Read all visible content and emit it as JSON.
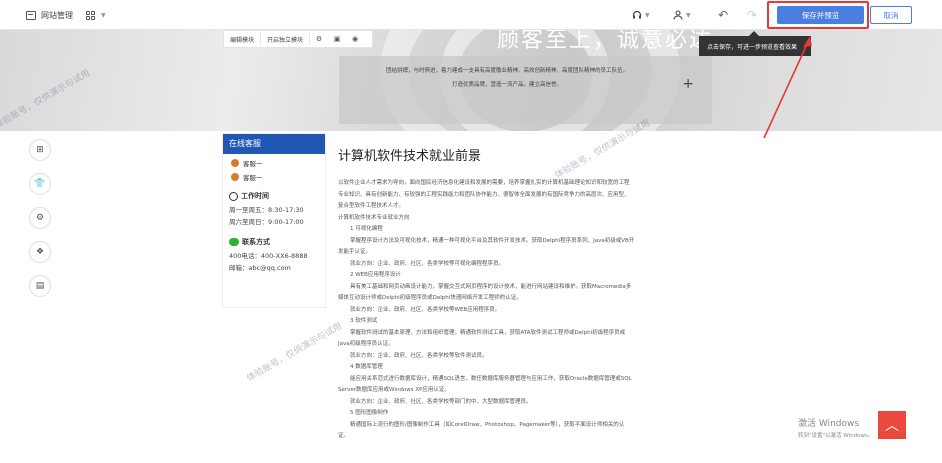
{
  "toolbar": {
    "site_manage": "网站管理",
    "save_preview": "保存并预览",
    "cancel": "取消"
  },
  "banner": {
    "title": "顾客至上，诚意必达",
    "text_line1": "团结拼搏，与时俱进，着力建成一支具有高度敬业精神、高效创新精神、高度团队精神的员工队伍，",
    "text_line2": "打造优质品牌，营造一流产品，建立高信誉。",
    "edit_toolbar": {
      "edit_module": "编辑模块",
      "open_independent": "开启独立模块"
    },
    "tooltip": "点击保存，可进一步预览查看效果"
  },
  "sidebar": {
    "header": "在线客服",
    "agents": [
      "客服一",
      "客服一"
    ],
    "work_time_title": "工作时间",
    "work_time": [
      "周一至周五：8:30-17:30",
      "周六至周日：9:00-17:00"
    ],
    "contact_title": "联系方式",
    "contact": [
      "400电话：400-XX6-8888",
      "邮箱：abc@qq.com"
    ]
  },
  "article": {
    "title": "计算机软件技术就业前景",
    "paragraphs": [
      {
        "t": "以软件企业人才需求为导向，面向国民经济信息化建设和发展的需要，培养掌握扎实的计算机基础理论知识和较宽的工程",
        "c": ""
      },
      {
        "t": "专业知识、具有创新能力、有较强的工程实践能力和团队协作能力、德智体全面发展的有国际竞争力的高层次、应用型、",
        "c": ""
      },
      {
        "t": "复合型软件工程技术人才。",
        "c": ""
      },
      {
        "t": "计算机软件技术专业就业方向",
        "c": ""
      },
      {
        "t": "1 可视化编程",
        "c": "ind2"
      },
      {
        "t": "掌握程序设计方法及可视化技术，精通一种可视化平台及其软件开发技术。获取Delphi程序员系列、Java初级或VB开",
        "c": "ind1"
      },
      {
        "t": "发能手认证。",
        "c": ""
      },
      {
        "t": "就业方向：企业、政府、社区、各类学校等可视化编程程序员。",
        "c": "ind1"
      },
      {
        "t": "2 WEB应用程序设计",
        "c": "ind2"
      },
      {
        "t": "具有美工基础和网页动画设计能力，掌握交互式网页程序的设计技术，能进行网站建设和维护。获取Macromedia多",
        "c": "ind1"
      },
      {
        "t": "媒体互动设计师或Delphi初级程序员或Delphi快速网络开发工程师的认证。",
        "c": ""
      },
      {
        "t": "就业方向：企业、政府、社区、各类学校等WEB应用程序员。",
        "c": "ind1"
      },
      {
        "t": "3 软件测试",
        "c": "ind2"
      },
      {
        "t": "掌握软件测试的基本原理、方法和组织管理，精通软件测试工具，获取ATA软件测试工程师或Delphi初级程序员或",
        "c": "ind1"
      },
      {
        "t": "Java初级程序员认证。",
        "c": ""
      },
      {
        "t": "就业方向：企业、政府、社区、各类学校等软件测试员。",
        "c": "ind1"
      },
      {
        "t": "4 数据库管理",
        "c": "ind2"
      },
      {
        "t": "能应用关系范式进行数据库设计，精通SQL语言，数任数据库服务器管理与应用工作，获取Oracle数据库管理或SQL",
        "c": "ind1"
      },
      {
        "t": "Server数据库应用或Windows XP应用认证。",
        "c": ""
      },
      {
        "t": "就业方向：企业、政府、社区、各类学校等部门的中、大型数据库管理员。",
        "c": "ind1"
      },
      {
        "t": "5 图形图像制作",
        "c": "ind2"
      },
      {
        "t": "精通国际上流行的图形/图像制作工具（如CorelDraw、Photoshop、Pagemaker等），获取平面设计师相关的认",
        "c": "ind1"
      },
      {
        "t": "证。",
        "c": ""
      }
    ]
  },
  "watermark": "体验账号，仅供演示与试用",
  "windows_activation": {
    "title": "激活 Windows",
    "subtitle": "转到\"设置\"以激活 Windows。"
  },
  "colors": {
    "accent": "#4a7fe0",
    "sidebar_header": "#1f57b3",
    "highlight": "#e53935",
    "to_top": "#e94a3c"
  }
}
